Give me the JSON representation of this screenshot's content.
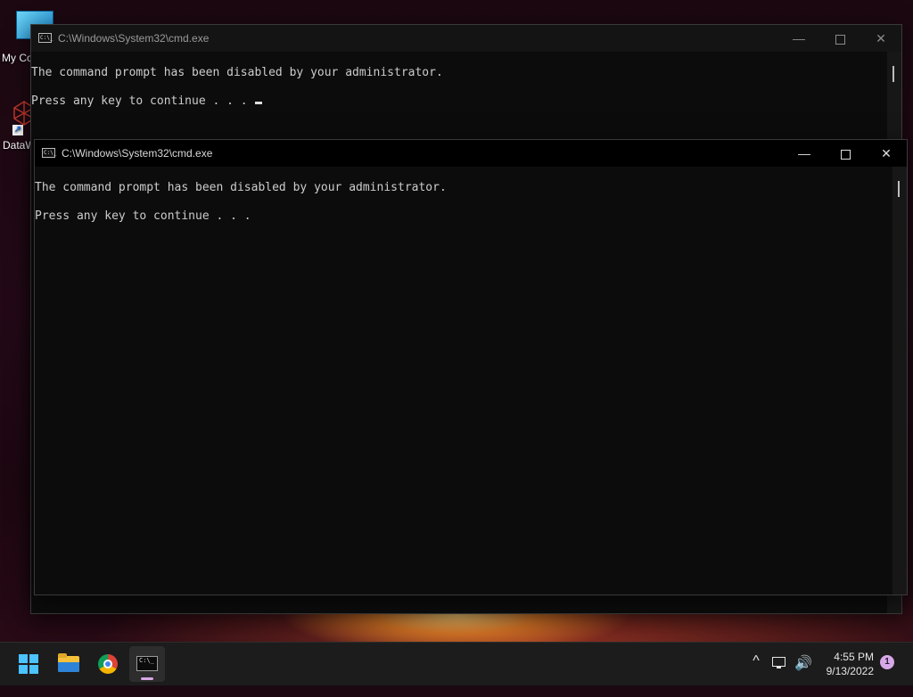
{
  "desktop": {
    "icons": [
      {
        "label": "My Co",
        "icon": "computer-icon"
      },
      {
        "label": "DataW",
        "icon": "datawarrior-icon"
      }
    ]
  },
  "back_window": {
    "title": "C:\\Windows\\System32\\cmd.exe",
    "lines": [
      "The command prompt has been disabled by your administrator.",
      "Press any key to continue . . ."
    ]
  },
  "front_window": {
    "title": "C:\\Windows\\System32\\cmd.exe",
    "lines": [
      "The command prompt has been disabled by your administrator.",
      "Press any key to continue . . ."
    ]
  },
  "window_controls": {
    "minimize": "—",
    "close": "✕"
  },
  "cmd_icon_text": "C:\\_",
  "taskbar": {
    "apps": [
      {
        "name": "Start",
        "icon": "windows-logo-icon"
      },
      {
        "name": "File Explorer",
        "icon": "folder-icon"
      },
      {
        "name": "Google Chrome",
        "icon": "chrome-icon"
      },
      {
        "name": "Command Prompt",
        "icon": "terminal-icon",
        "active": true
      }
    ],
    "tray": {
      "chevron": "^",
      "volume_glyph": "🔊",
      "time": "4:55 PM",
      "date": "9/13/2022",
      "notification_count": "1"
    }
  }
}
